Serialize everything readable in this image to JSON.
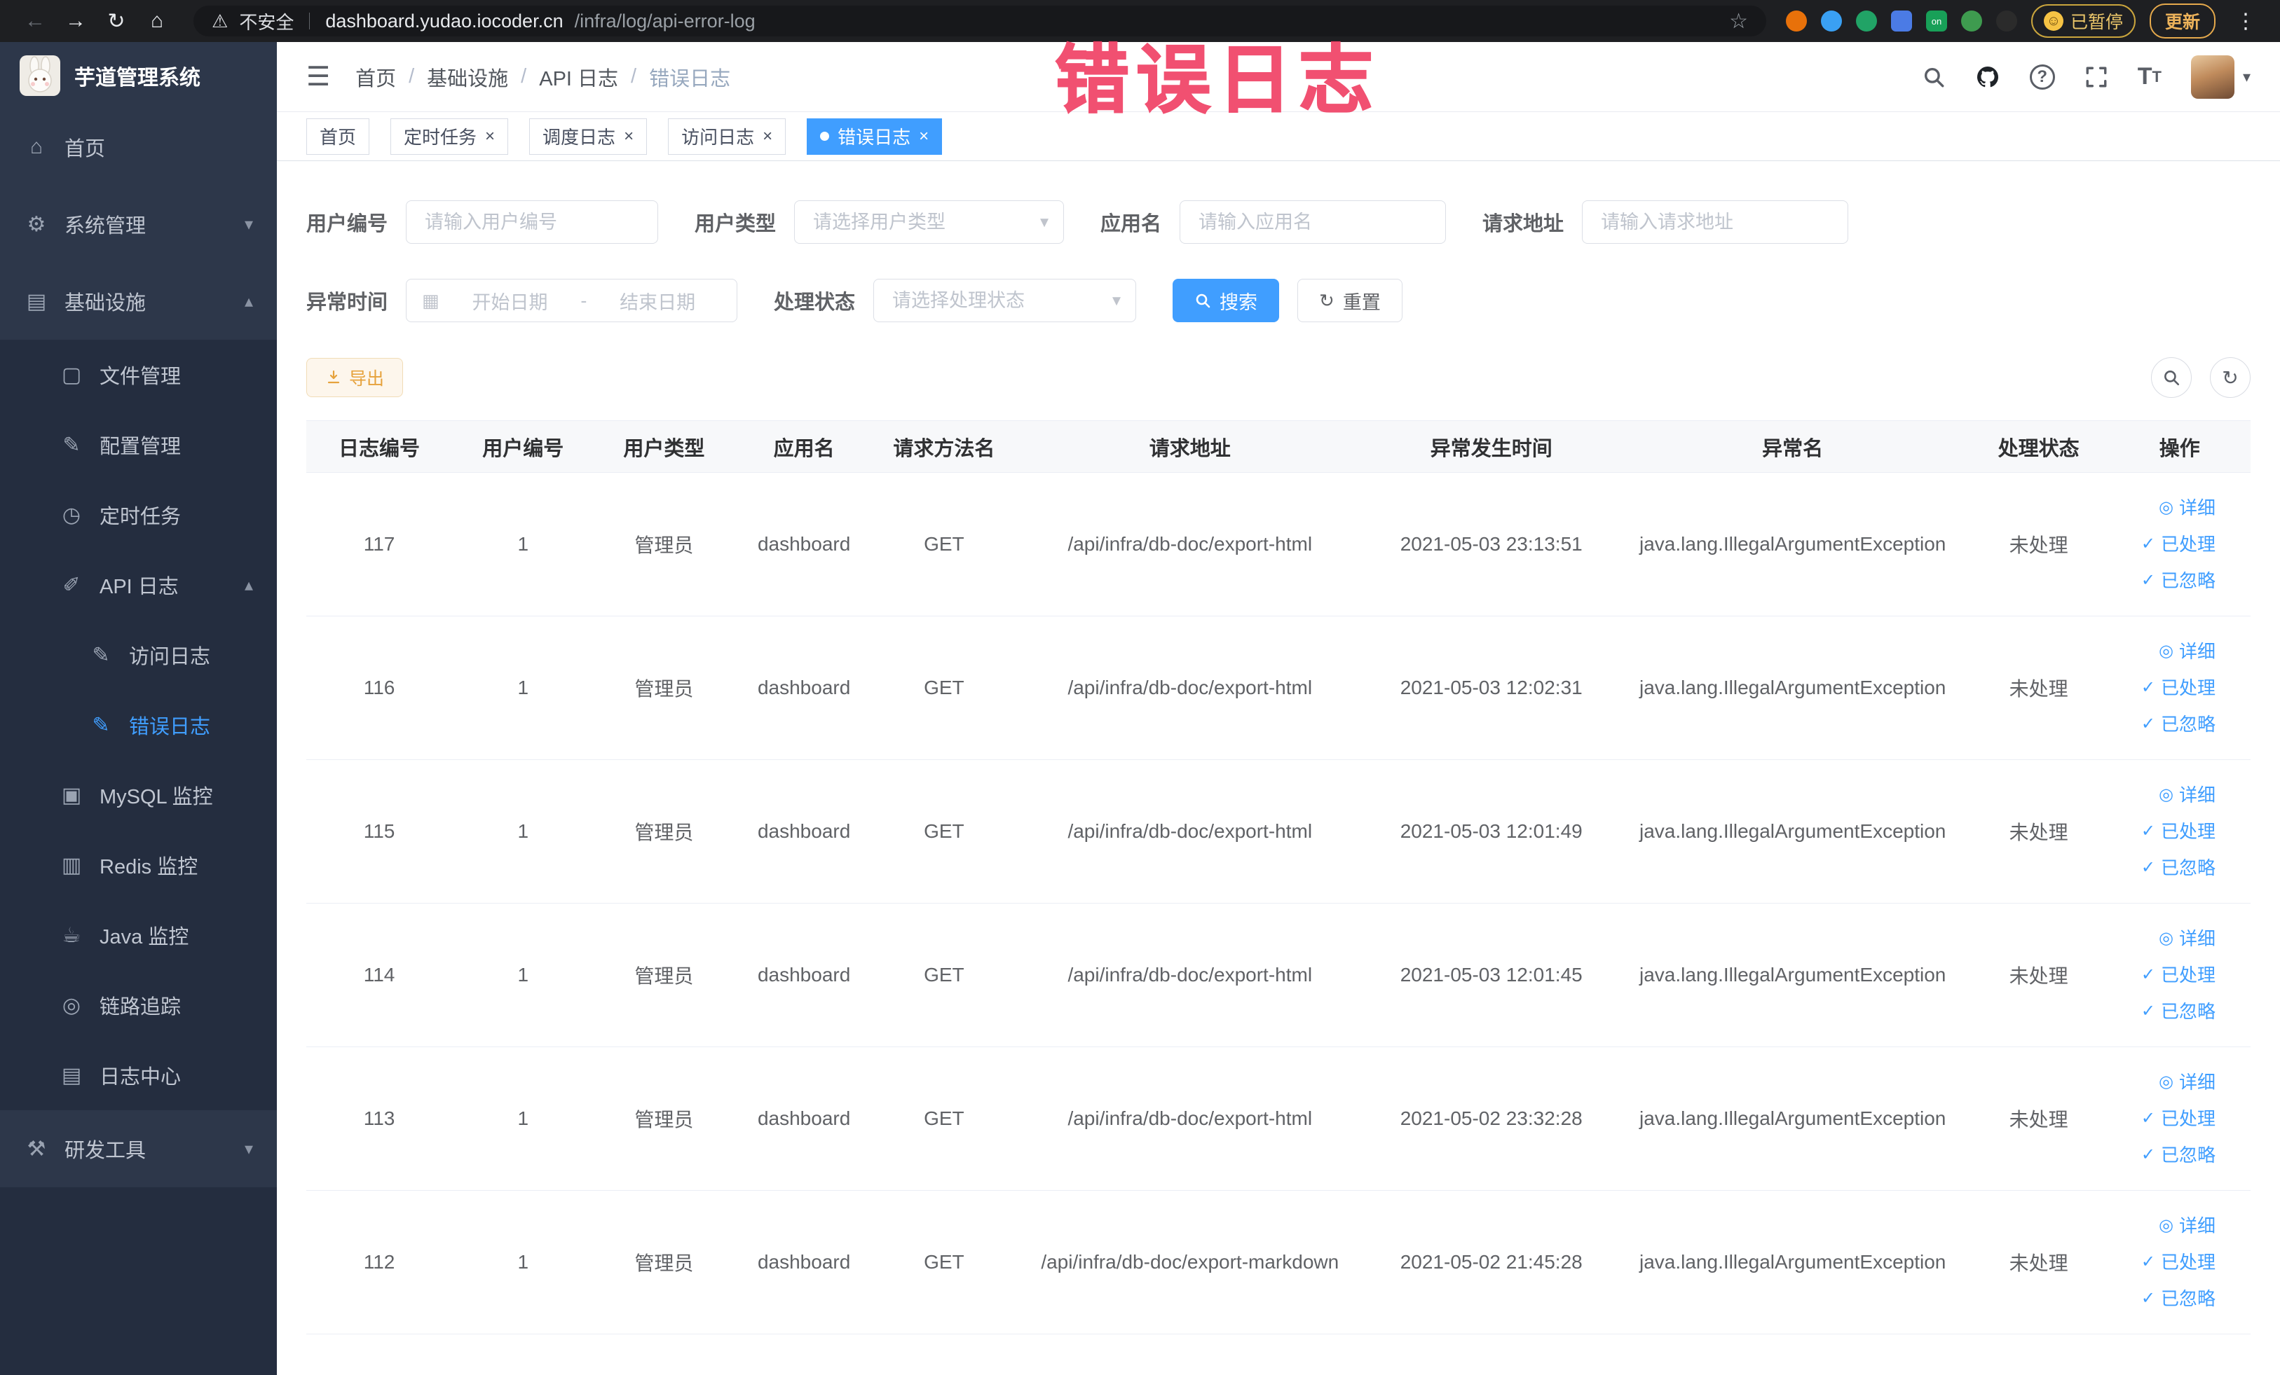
{
  "colors": {
    "primary": "#409eff",
    "warning": "#e6a23c",
    "sidebar_bg": "#242d3f",
    "sidebar_item_bg": "#2d374a",
    "annotation_red": "#f03e62",
    "chrome_bg": "#1e1f22"
  },
  "annotation": {
    "text": "错误日志"
  },
  "browser": {
    "security_label": "不安全",
    "url_host": "dashboard.yudao.iocoder.cn",
    "url_path": "/infra/log/api-error-log",
    "paused_label": "已暂停",
    "update_label": "更新",
    "on_badge": "on"
  },
  "icons": {
    "back": "←",
    "forward": "→",
    "reload": "↻",
    "home": "⌂",
    "warning": "⚠",
    "star": "☆",
    "kebab": "⋮",
    "smiley": "☺",
    "hamburger": "☰",
    "caret_down": "▾",
    "arrow_up": "▴",
    "arrow_down": "▾",
    "calendar": "▦",
    "check": "✓",
    "eye": "◎",
    "close": "×",
    "slash": "/",
    "refresh": "↻"
  },
  "sidebar": {
    "logo_title": "芋道管理系统",
    "items": [
      {
        "label": "首页",
        "icon": "⌂"
      },
      {
        "label": "系统管理",
        "icon": "⚙",
        "arrow": "▾"
      },
      {
        "label": "基础设施",
        "icon": "▤",
        "arrow": "▴"
      },
      {
        "label": "文件管理",
        "icon": "▢"
      },
      {
        "label": "配置管理",
        "icon": "✎"
      },
      {
        "label": "定时任务",
        "icon": "◷"
      },
      {
        "label": "API 日志",
        "icon": "✐",
        "arrow": "▴"
      },
      {
        "label": "访问日志",
        "icon": "✎"
      },
      {
        "label": "错误日志",
        "icon": "✎",
        "active": true
      },
      {
        "label": "MySQL 监控",
        "icon": "▣"
      },
      {
        "label": "Redis 监控",
        "icon": "▥"
      },
      {
        "label": "Java 监控",
        "icon": "☕"
      },
      {
        "label": "链路追踪",
        "icon": "◎"
      },
      {
        "label": "日志中心",
        "icon": "▤"
      },
      {
        "label": "研发工具",
        "icon": "⚒",
        "arrow": "▾"
      }
    ]
  },
  "breadcrumb": [
    "首页",
    "基础设施",
    "API 日志",
    "错误日志"
  ],
  "tabs": [
    {
      "label": "首页",
      "closable": false,
      "active": false
    },
    {
      "label": "定时任务",
      "closable": true,
      "active": false
    },
    {
      "label": "调度日志",
      "closable": true,
      "active": false
    },
    {
      "label": "访问日志",
      "closable": true,
      "active": false
    },
    {
      "label": "错误日志",
      "closable": true,
      "active": true
    }
  ],
  "filters": {
    "user_id_label": "用户编号",
    "user_id_placeholder": "请输入用户编号",
    "user_type_label": "用户类型",
    "user_type_placeholder": "请选择用户类型",
    "app_name_label": "应用名",
    "app_name_placeholder": "请输入应用名",
    "request_url_label": "请求地址",
    "request_url_placeholder": "请输入请求地址",
    "exception_time_label": "异常时间",
    "date_start_placeholder": "开始日期",
    "date_separator": "-",
    "date_end_placeholder": "结束日期",
    "process_status_label": "处理状态",
    "process_status_placeholder": "请选择处理状态",
    "search_label": "搜索",
    "reset_label": "重置"
  },
  "toolbar": {
    "export_label": "导出"
  },
  "table": {
    "columns": [
      "日志编号",
      "用户编号",
      "用户类型",
      "应用名",
      "请求方法名",
      "请求地址",
      "异常发生时间",
      "异常名",
      "处理状态",
      "操作"
    ],
    "row_actions": [
      "详细",
      "已处理",
      "已忽略"
    ],
    "rows": [
      {
        "id": "117",
        "user_id": "1",
        "user_type": "管理员",
        "app": "dashboard",
        "method": "GET",
        "url": "/api/infra/db-doc/export-html",
        "time": "2021-05-03 23:13:51",
        "exception": "java.lang.IllegalArgumentException",
        "status": "未处理"
      },
      {
        "id": "116",
        "user_id": "1",
        "user_type": "管理员",
        "app": "dashboard",
        "method": "GET",
        "url": "/api/infra/db-doc/export-html",
        "time": "2021-05-03 12:02:31",
        "exception": "java.lang.IllegalArgumentException",
        "status": "未处理"
      },
      {
        "id": "115",
        "user_id": "1",
        "user_type": "管理员",
        "app": "dashboard",
        "method": "GET",
        "url": "/api/infra/db-doc/export-html",
        "time": "2021-05-03 12:01:49",
        "exception": "java.lang.IllegalArgumentException",
        "status": "未处理"
      },
      {
        "id": "114",
        "user_id": "1",
        "user_type": "管理员",
        "app": "dashboard",
        "method": "GET",
        "url": "/api/infra/db-doc/export-html",
        "time": "2021-05-03 12:01:45",
        "exception": "java.lang.IllegalArgumentException",
        "status": "未处理"
      },
      {
        "id": "113",
        "user_id": "1",
        "user_type": "管理员",
        "app": "dashboard",
        "method": "GET",
        "url": "/api/infra/db-doc/export-html",
        "time": "2021-05-02 23:32:28",
        "exception": "java.lang.IllegalArgumentException",
        "status": "未处理"
      },
      {
        "id": "112",
        "user_id": "1",
        "user_type": "管理员",
        "app": "dashboard",
        "method": "GET",
        "url": "/api/infra/db-doc/export-markdown",
        "time": "2021-05-02 21:45:28",
        "exception": "java.lang.IllegalArgumentException",
        "status": "未处理"
      }
    ]
  }
}
